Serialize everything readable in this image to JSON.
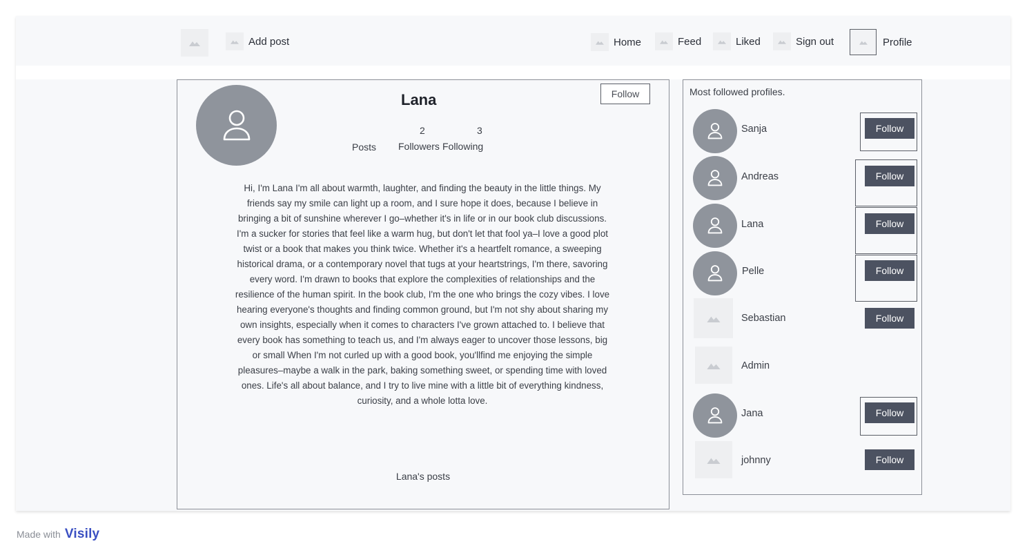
{
  "nav": {
    "add_post": "Add post",
    "home": "Home",
    "feed": "Feed",
    "liked": "Liked",
    "sign_out": "Sign out",
    "profile": "Profile"
  },
  "profile": {
    "name": "Lana",
    "follow_label": "Follow",
    "posts_count": "",
    "followers_count": "2",
    "following_count": "3",
    "posts_label": "Posts",
    "followers_label": "Followers",
    "following_label": "Following",
    "bio": "Hi, I'm Lana  I'm all about warmth, laughter, and finding the beauty in the little things. My friends say my smile can light up a room, and I sure hope it does, because I believe in bringing a bit of sunshine wherever I go–whether it's in life or in our book club discussions. I'm a sucker for stories that feel like a warm hug, but don't let that fool ya–I love a good plot twist or a book that makes you think twice. Whether it's a heartfelt romance, a sweeping historical drama, or a contemporary novel that tugs at your heartstrings, I'm there, savoring every word. I'm drawn to books that explore the complexities of relationships and the resilience of the human spirit. In the book club, I'm the one who brings the cozy vibes. I love hearing everyone's thoughts and finding common ground, but I'm not shy about sharing my own insights, especially when it comes to characters I've grown attached to. I believe that every book has something to teach us, and I'm always eager to uncover those lessons, big or small When I'm not curled up with a good book, you'llfind me enjoying the simple pleasures–maybe a walk in the park, baking something sweet, or spending time with loved ones. Life's all about balance, and I try to live mine with a little bit of everything kindness, curiosity, and a whole lotta love.",
    "posts_title": "Lana's posts"
  },
  "sidebar": {
    "title": "Most followed profiles.",
    "follow_label": "Follow",
    "users": [
      {
        "name": "Sanja",
        "avatar": "person-icon",
        "button": "Follow"
      },
      {
        "name": "Andreas",
        "avatar": "person-icon",
        "button": "Follow"
      },
      {
        "name": "Lana",
        "avatar": "person-icon",
        "button": "Follow"
      },
      {
        "name": "Pelle",
        "avatar": "person-icon",
        "button": "Follow"
      },
      {
        "name": "Sebastian",
        "avatar": "image-placeholder-icon",
        "button": "Follow"
      },
      {
        "name": "Admin",
        "avatar": "image-placeholder-icon",
        "button": ""
      },
      {
        "name": "Jana",
        "avatar": "person-icon",
        "button": "Follow"
      },
      {
        "name": "johnny",
        "avatar": "image-placeholder-icon",
        "button": "Follow"
      }
    ]
  },
  "footer": {
    "made_with": "Made with",
    "brand": "Visily"
  },
  "colors": {
    "page_bg": "#f7f8fa",
    "avatar_gray": "#8f949c",
    "button_dark": "#4c5261",
    "brand_blue": "#3a4fc2"
  }
}
